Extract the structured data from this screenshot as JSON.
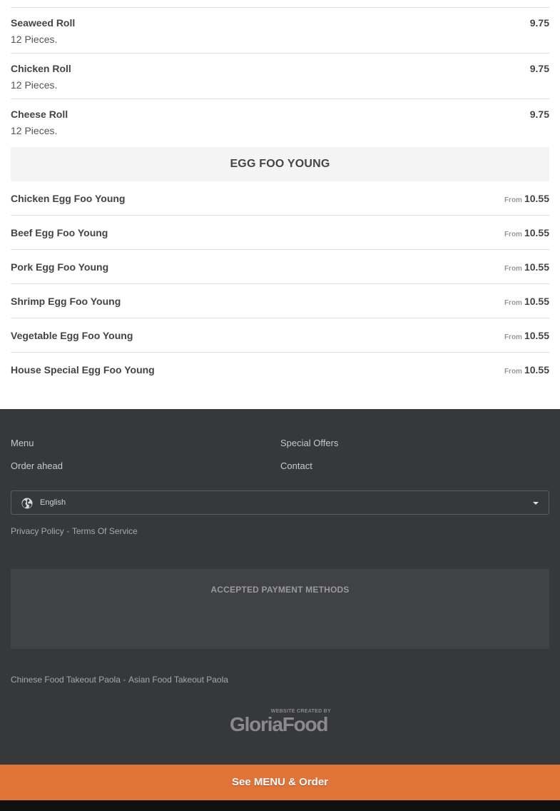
{
  "rolls": [
    {
      "name": "Seaweed Roll",
      "desc": "12 Pieces.",
      "price": "9.75"
    },
    {
      "name": "Chicken Roll",
      "desc": "12 Pieces.",
      "price": "9.75"
    },
    {
      "name": "Cheese Roll",
      "desc": "12 Pieces.",
      "price": "9.75"
    }
  ],
  "category": {
    "title": "EGG FOO YOUNG"
  },
  "egg_foo_young": [
    {
      "name": "Chicken Egg Foo Young",
      "from": "From",
      "price": "10.55"
    },
    {
      "name": "Beef Egg Foo Young",
      "from": "From",
      "price": "10.55"
    },
    {
      "name": "Pork Egg Foo Young",
      "from": "From",
      "price": "10.55"
    },
    {
      "name": "Shrimp Egg Foo Young",
      "from": "From",
      "price": "10.55"
    },
    {
      "name": "Vegetable Egg Foo Young",
      "from": "From",
      "price": "10.55"
    },
    {
      "name": "House Special Egg Foo Young",
      "from": "From",
      "price": "10.55"
    }
  ],
  "footer": {
    "links": {
      "menu": "Menu",
      "special_offers": "Special Offers",
      "order_ahead": "Order ahead",
      "contact": "Contact"
    },
    "language": {
      "selected": "English",
      "icon": "globe-icon"
    },
    "legal": {
      "privacy": "Privacy Policy",
      "terms": "Terms Of Service",
      "separator": "•"
    },
    "payments_title": "ACCEPTED PAYMENT METHODS",
    "seo": {
      "chinese": "Chinese Food Takeout Paola",
      "asian": "Asian Food Takeout Paola",
      "separator": "•"
    },
    "brand": {
      "tagline": "WEBSITE CREATED BY",
      "name": "GloriaFood"
    }
  },
  "cta": {
    "label": "See MENU & Order"
  },
  "colors": {
    "accent": "#e07337",
    "footer_bg": "#36383c",
    "category_bg": "#f4f4f4"
  }
}
